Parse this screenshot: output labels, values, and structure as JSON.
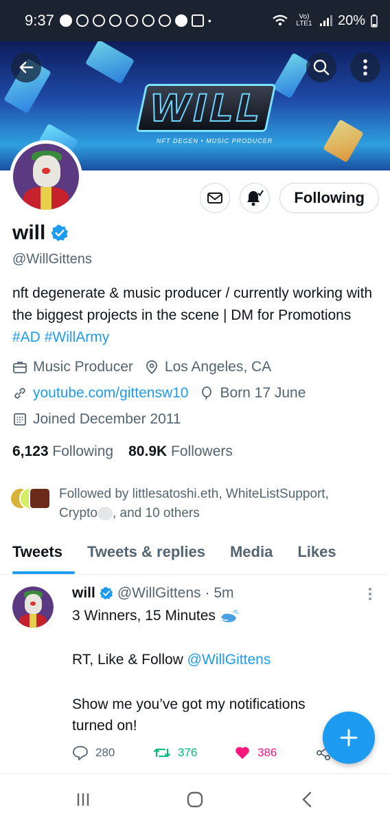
{
  "status_bar": {
    "time": "9:37",
    "network": "Vo) LTE1",
    "battery": "20%"
  },
  "banner": {
    "logo_text": "WILL",
    "subtitle": "NFT DEGEN • MUSIC PRODUCER"
  },
  "profile": {
    "name": "will",
    "handle": "@WillGittens",
    "bio_text": "nft degenerate & music producer / currently working with the biggest projects in the scene | DM for Promotions ",
    "hashtags": [
      "#AD",
      "#WillArmy"
    ],
    "occupation": "Music Producer",
    "location": "Los Angeles, CA",
    "website": "youtube.com/gittensw10",
    "born": "Born 17 June",
    "joined": "Joined December 2011",
    "following_count": "6,123",
    "following_label": "Following",
    "followers_count": "80.9K",
    "followers_label": "Followers",
    "following_button": "Following",
    "followed_by_prefix": "Followed by littlesatoshi.eth, WhiteListSupport,",
    "followed_by_line2_a": "Crypto",
    "followed_by_line2_b": ", and 10 others"
  },
  "tabs": [
    {
      "label": "Tweets",
      "active": true
    },
    {
      "label": "Tweets & replies",
      "active": false
    },
    {
      "label": "Media",
      "active": false
    },
    {
      "label": "Likes",
      "active": false
    }
  ],
  "tweet": {
    "name": "will",
    "handle": "@WillGittens",
    "time": "· 5m",
    "line1": "3 Winners, 15 Minutes",
    "line2_prefix": "RT, Like & Follow ",
    "line2_mention": "@WillGittens",
    "line3": "Show me you’ve got my notifications",
    "line4": "turned on!",
    "replies": "280",
    "retweets": "376",
    "likes": "386"
  },
  "colors": {
    "accent": "#1d9bf0",
    "retweet": "#00ba7c",
    "like": "#f91880"
  }
}
